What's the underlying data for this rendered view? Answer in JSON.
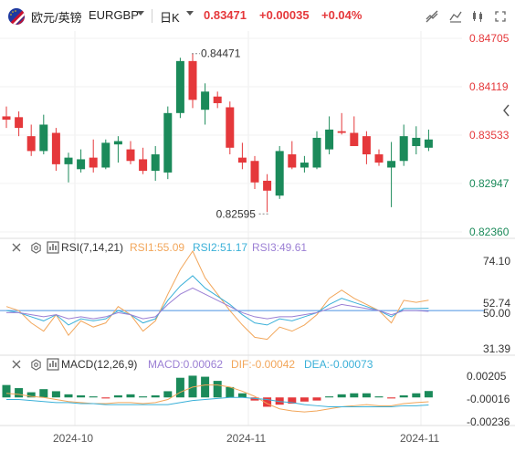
{
  "header": {
    "pair_name": "欧元/英镑",
    "symbol": "EURGBP",
    "period": "日K",
    "last_price": "0.83471",
    "change": "+0.00035",
    "change_pct": "+0.04%",
    "toolbar_icons": [
      "draw-line-icon",
      "indicator-settings-icon",
      "candle-type-icon",
      "fullscreen-icon",
      "close-icon"
    ]
  },
  "colors": {
    "up": "#1b8a5a",
    "down": "#e5383b",
    "rsi1": "#f2a65a",
    "rsi2": "#3ab0d8",
    "rsi3": "#9b7fd4",
    "macd_dif": "#f2a65a",
    "macd_dea": "#3ab0d8",
    "price_axis": "#e5383b",
    "price_axis_low": "#1b8a5a",
    "level_line": "#4a90e2"
  },
  "chart_data": [
    {
      "type": "candlestick",
      "title": "EURGBP 日K",
      "price_ticks": [
        "0.84705",
        "0.84119",
        "0.83533",
        "0.82947",
        "0.82360"
      ],
      "ylim": [
        0.8236,
        0.84705
      ],
      "x_labels": [
        "2024-10",
        "2024-11",
        "2024-11"
      ],
      "annotations": [
        {
          "label": "0.84471",
          "kind": "high"
        },
        {
          "label": "0.82595",
          "kind": "low"
        }
      ],
      "candles": [
        {
          "o": 0.8376,
          "h": 0.8388,
          "l": 0.8362,
          "c": 0.8372
        },
        {
          "o": 0.8375,
          "h": 0.8382,
          "l": 0.8352,
          "c": 0.8362
        },
        {
          "o": 0.8352,
          "h": 0.8366,
          "l": 0.8328,
          "c": 0.8334
        },
        {
          "o": 0.8334,
          "h": 0.8378,
          "l": 0.833,
          "c": 0.8366
        },
        {
          "o": 0.8356,
          "h": 0.8362,
          "l": 0.831,
          "c": 0.8318
        },
        {
          "o": 0.8318,
          "h": 0.8332,
          "l": 0.8296,
          "c": 0.8326
        },
        {
          "o": 0.8312,
          "h": 0.8336,
          "l": 0.8308,
          "c": 0.8324
        },
        {
          "o": 0.8326,
          "h": 0.8348,
          "l": 0.8308,
          "c": 0.8314
        },
        {
          "o": 0.8314,
          "h": 0.8348,
          "l": 0.8312,
          "c": 0.8344
        },
        {
          "o": 0.8342,
          "h": 0.8352,
          "l": 0.832,
          "c": 0.8346
        },
        {
          "o": 0.8336,
          "h": 0.8346,
          "l": 0.8318,
          "c": 0.8322
        },
        {
          "o": 0.8324,
          "h": 0.8338,
          "l": 0.8306,
          "c": 0.831
        },
        {
          "o": 0.831,
          "h": 0.834,
          "l": 0.8298,
          "c": 0.833
        },
        {
          "o": 0.8308,
          "h": 0.8388,
          "l": 0.83,
          "c": 0.838
        },
        {
          "o": 0.838,
          "h": 0.8447,
          "l": 0.8374,
          "c": 0.8443
        },
        {
          "o": 0.8443,
          "h": 0.8452,
          "l": 0.8386,
          "c": 0.8396
        },
        {
          "o": 0.8384,
          "h": 0.8416,
          "l": 0.8366,
          "c": 0.8406
        },
        {
          "o": 0.84,
          "h": 0.8406,
          "l": 0.8386,
          "c": 0.8392
        },
        {
          "o": 0.8387,
          "h": 0.8394,
          "l": 0.833,
          "c": 0.8338
        },
        {
          "o": 0.8326,
          "h": 0.8344,
          "l": 0.8312,
          "c": 0.832
        },
        {
          "o": 0.8322,
          "h": 0.8328,
          "l": 0.8288,
          "c": 0.8296
        },
        {
          "o": 0.8298,
          "h": 0.8306,
          "l": 0.826,
          "c": 0.8286
        },
        {
          "o": 0.828,
          "h": 0.834,
          "l": 0.8276,
          "c": 0.8334
        },
        {
          "o": 0.833,
          "h": 0.8346,
          "l": 0.8312,
          "c": 0.8314
        },
        {
          "o": 0.8314,
          "h": 0.8328,
          "l": 0.8308,
          "c": 0.832
        },
        {
          "o": 0.8314,
          "h": 0.8358,
          "l": 0.8312,
          "c": 0.835
        },
        {
          "o": 0.8336,
          "h": 0.8376,
          "l": 0.833,
          "c": 0.836
        },
        {
          "o": 0.8358,
          "h": 0.838,
          "l": 0.8354,
          "c": 0.8356
        },
        {
          "o": 0.8356,
          "h": 0.8376,
          "l": 0.834,
          "c": 0.834
        },
        {
          "o": 0.8352,
          "h": 0.8358,
          "l": 0.8318,
          "c": 0.833
        },
        {
          "o": 0.833,
          "h": 0.8336,
          "l": 0.8316,
          "c": 0.832
        },
        {
          "o": 0.8314,
          "h": 0.8345,
          "l": 0.8266,
          "c": 0.8322
        },
        {
          "o": 0.8322,
          "h": 0.8366,
          "l": 0.8316,
          "c": 0.8352
        },
        {
          "o": 0.834,
          "h": 0.8364,
          "l": 0.833,
          "c": 0.835
        },
        {
          "o": 0.8338,
          "h": 0.836,
          "l": 0.8334,
          "c": 0.8348
        }
      ]
    },
    {
      "type": "line",
      "title": "RSI(7,14,21)",
      "legend": [
        "RSI1:55.09",
        "RSI2:51.17",
        "RSI3:49.61"
      ],
      "ticks": [
        "74.10",
        "52.74",
        "50.00",
        "31.39"
      ],
      "ylim": [
        31.39,
        74.1
      ],
      "level": 50,
      "series": [
        {
          "name": "RSI1",
          "values": [
            52,
            50,
            44,
            40,
            48,
            38,
            45,
            42,
            44,
            52,
            48,
            40,
            45,
            58,
            70,
            79,
            66,
            58,
            50,
            43,
            37,
            36,
            42,
            40,
            43,
            48,
            56,
            60,
            56,
            53,
            50,
            44,
            55,
            54,
            55.09
          ]
        },
        {
          "name": "RSI2",
          "values": [
            50,
            49,
            47,
            45,
            48,
            43,
            46,
            45,
            46,
            50,
            48,
            44,
            46,
            55,
            62,
            67,
            61,
            57,
            53,
            48,
            44,
            43,
            46,
            45,
            47,
            49,
            53,
            56,
            54,
            52,
            50,
            47,
            51,
            51,
            51.17
          ]
        },
        {
          "name": "RSI3",
          "values": [
            49,
            49,
            48,
            47,
            48,
            46,
            47,
            46,
            47,
            49,
            48,
            46,
            47,
            53,
            58,
            61,
            58,
            55,
            52,
            49,
            47,
            46,
            47,
            47,
            48,
            49,
            51,
            53,
            52,
            51,
            50,
            48,
            50,
            50,
            49.61
          ]
        }
      ]
    },
    {
      "type": "bar",
      "title": "MACD(12,26,9)",
      "legend": [
        "MACD:0.00062",
        "DIF:-0.00042",
        "DEA:-0.00073"
      ],
      "ticks": [
        "0.00205",
        "-0.00016",
        "-0.00236"
      ],
      "ylim": [
        -0.00236,
        0.00205
      ],
      "series": [
        {
          "name": "MACD",
          "values": [
            0.0012,
            0.0009,
            0.0005,
            0.0008,
            0.0006,
            0.0003,
            0.0002,
            0.0001,
            -0.0001,
            0.0002,
            0.0003,
            0.0001,
            0.0002,
            0.0006,
            0.0019,
            0.0021,
            0.002,
            0.0016,
            0.001,
            0.0004,
            -0.0003,
            -0.0009,
            -0.0007,
            -0.0006,
            -0.0004,
            -0.0003,
            0.0001,
            0.0003,
            0.0004,
            0.0004,
            0.0001,
            -0.0001,
            0.0002,
            0.0004,
            0.00062
          ]
        },
        {
          "name": "DIF",
          "values": [
            0.0004,
            0.0003,
            0.0001,
            0.0,
            -0.0002,
            -0.0004,
            -0.0005,
            -0.0006,
            -0.0006,
            -0.0005,
            -0.0005,
            -0.0006,
            -0.0005,
            -0.0002,
            0.0005,
            0.001,
            0.0012,
            0.0012,
            0.001,
            0.0006,
            0.0001,
            -0.0006,
            -0.0011,
            -0.0013,
            -0.0014,
            -0.0013,
            -0.0011,
            -0.0009,
            -0.0008,
            -0.0007,
            -0.0008,
            -0.0008,
            -0.0006,
            -0.0005,
            -0.00042
          ]
        },
        {
          "name": "DEA",
          "values": [
            -0.0002,
            -0.0002,
            -0.0003,
            -0.0004,
            -0.0005,
            -0.0005,
            -0.0006,
            -0.0006,
            -0.0007,
            -0.0007,
            -0.0007,
            -0.0007,
            -0.0007,
            -0.0007,
            -0.0005,
            -0.0003,
            -0.0002,
            -0.0001,
            0.0,
            0.0,
            -0.0001,
            -0.0002,
            -0.0004,
            -0.0005,
            -0.0007,
            -0.0008,
            -0.0009,
            -0.0009,
            -0.0009,
            -0.0009,
            -0.0009,
            -0.0009,
            -0.0008,
            -0.0008,
            -0.00073
          ]
        }
      ]
    }
  ]
}
